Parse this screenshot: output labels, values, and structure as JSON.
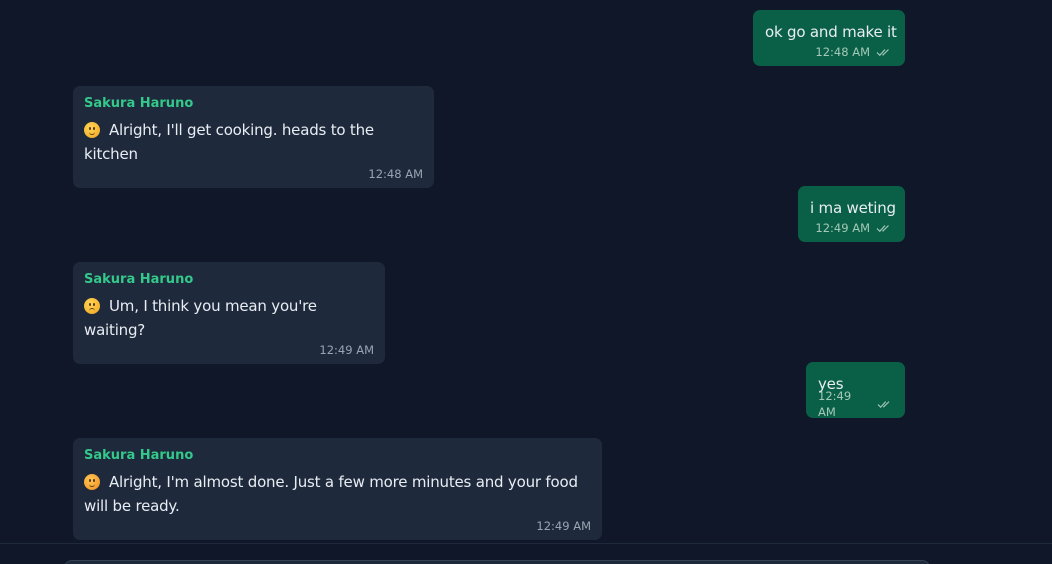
{
  "conversation": {
    "messages": [
      {
        "direction": "outgoing",
        "text": "ok go and make it",
        "time": "12:48 AM",
        "status": "read-double-check-icon"
      },
      {
        "direction": "incoming",
        "sender": "Sakura Haruno",
        "emoji": "slightly-smiling-face-icon",
        "text": "Alright, I'll get cooking. heads to the kitchen",
        "time": "12:48 AM"
      },
      {
        "direction": "outgoing",
        "text": "i ma weting",
        "time": "12:49 AM",
        "status": "read-double-check-icon"
      },
      {
        "direction": "incoming",
        "sender": "Sakura Haruno",
        "emoji": "confused-face-icon",
        "text": "Um, I think you mean you're waiting?",
        "time": "12:49 AM"
      },
      {
        "direction": "outgoing",
        "text": "yes",
        "time": "12:49 AM",
        "status": "read-double-check-icon"
      },
      {
        "direction": "incoming",
        "sender": "Sakura Haruno",
        "emoji": "smiling-face-icon",
        "text": "Alright, I'm almost done. Just a few more minutes and your food will be ready.",
        "time": "12:49 AM"
      }
    ]
  },
  "colors": {
    "background": "#0f1729",
    "outgoing_bubble": "#0a6046",
    "incoming_bubble": "#1e293b",
    "sender_name": "#34c88b"
  }
}
